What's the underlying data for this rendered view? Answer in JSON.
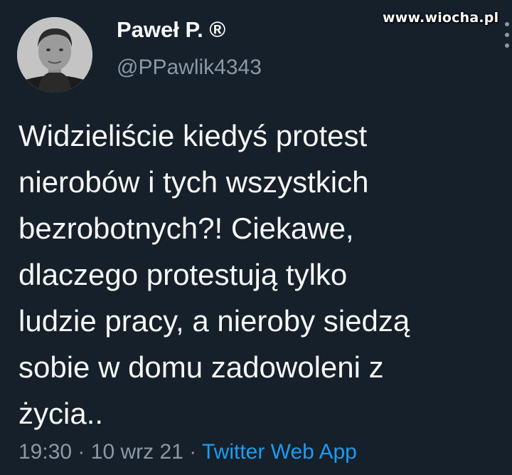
{
  "watermark": "www.wiocha.pl",
  "author": {
    "display_name": "Paweł P. ®",
    "handle": "@PPawlik4343"
  },
  "tweet": {
    "lines": [
      "Widzieliście kiedyś protest",
      "nierobów i tych wszystkich",
      "bezrobotnych?! Ciekawe,",
      "dlaczego protestują tylko",
      "ludzie pracy, a nieroby siedzą",
      "sobie w domu zadowoleni z",
      "życia.."
    ]
  },
  "meta": {
    "time": "19:30",
    "separator": "·",
    "date": "10 wrz 21",
    "source": "Twitter Web App"
  },
  "colors": {
    "background": "#15202b",
    "text": "#f7f9f9",
    "secondary": "#8b98a5",
    "link": "#1d9bf0"
  },
  "icons": {
    "more": "more-vertical-icon"
  }
}
